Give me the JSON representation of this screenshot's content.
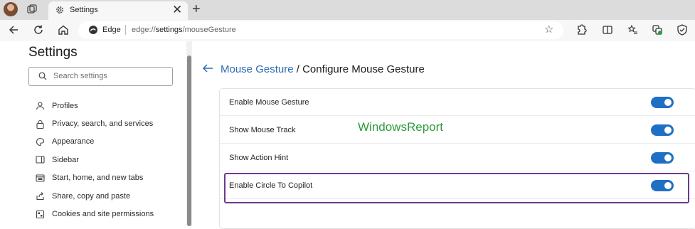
{
  "tab": {
    "title": "Settings",
    "close": "✕",
    "new_tab": "+"
  },
  "address": {
    "site_label": "Edge",
    "url_scheme": "edge://",
    "url_host": "settings",
    "url_path": "/mouseGesture"
  },
  "sidebar": {
    "heading": "Settings",
    "search_placeholder": "Search settings",
    "items": [
      {
        "label": "Profiles",
        "icon": "profile-icon"
      },
      {
        "label": "Privacy, search, and services",
        "icon": "lock-icon"
      },
      {
        "label": "Appearance",
        "icon": "appearance-icon"
      },
      {
        "label": "Sidebar",
        "icon": "sidebar-icon"
      },
      {
        "label": "Start, home, and new tabs",
        "icon": "home-tabs-icon"
      },
      {
        "label": "Share, copy and paste",
        "icon": "share-icon"
      },
      {
        "label": "Cookies and site permissions",
        "icon": "cookies-icon"
      }
    ]
  },
  "main": {
    "breadcrumb_parent": "Mouse Gesture",
    "breadcrumb_sep": " / ",
    "breadcrumb_current": "Configure Mouse Gesture",
    "watermark": "WindowsReport",
    "rows": [
      {
        "label": "Enable Mouse Gesture",
        "enabled": true
      },
      {
        "label": "Show Mouse Track",
        "enabled": true
      },
      {
        "label": "Show Action Hint",
        "enabled": true
      },
      {
        "label": "Enable Circle To Copilot",
        "enabled": true
      }
    ]
  },
  "colors": {
    "accent": "#1f6fc5",
    "link": "#2a6bb5",
    "highlight_border": "#6b3a8f",
    "watermark": "#2e9b3c"
  }
}
